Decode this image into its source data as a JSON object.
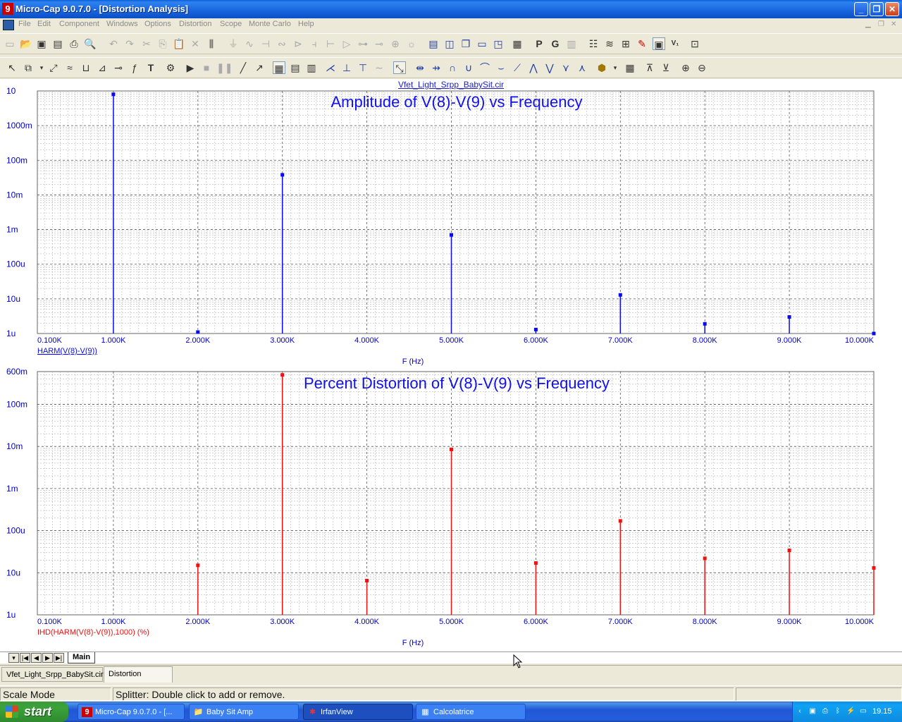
{
  "window": {
    "app_icon": "9",
    "title": "Micro-Cap 9.0.7.0 - [Distortion Analysis]",
    "controls": {
      "minimize": "_",
      "restore": "❐",
      "close": "✕"
    }
  },
  "menu": [
    "File",
    "Edit",
    "Component",
    "Windows",
    "Options",
    "Distortion",
    "Scope",
    "Monte Carlo",
    "Help"
  ],
  "toolbar_text": {
    "p": "P",
    "g": "G",
    "t": "T"
  },
  "plot": {
    "filename": "Vfet_Light_Srpp_BabySit.cir",
    "x_axis_label": "F (Hz)",
    "x_ticks": [
      "0.100K",
      "1.000K",
      "2.000K",
      "3.000K",
      "4.000K",
      "5.000K",
      "6.000K",
      "7.000K",
      "8.000K",
      "9.000K",
      "10.000K"
    ],
    "color_top": "#0a0aee",
    "color_bottom": "#ee1111"
  },
  "chart_data": [
    {
      "type": "bar",
      "title": "Amplitude of V(8)-V(9) vs Frequency",
      "xlabel": "F (Hz)",
      "ylabel": "",
      "y_scale": "log",
      "ylim": [
        1e-06,
        10
      ],
      "xlim": [
        100,
        10000
      ],
      "y_tick_labels": [
        "10",
        "1000m",
        "100m",
        "10m",
        "1m",
        "100u",
        "10u",
        "1u"
      ],
      "series": [
        {
          "name": "HARM(V(8)-V(9))",
          "x": [
            1000,
            2000,
            3000,
            5000,
            6000,
            7000,
            8000,
            9000,
            10000
          ],
          "y": [
            8.0,
            1.1e-06,
            0.038,
            0.0007,
            1.3e-06,
            1.3e-05,
            1.9e-06,
            3e-06,
            1e-06
          ]
        }
      ]
    },
    {
      "type": "bar",
      "title": "Percent Distortion of V(8)-V(9) vs Frequency",
      "xlabel": "F (Hz)",
      "ylabel": "",
      "y_scale": "log",
      "ylim": [
        1e-06,
        0.6
      ],
      "xlim": [
        100,
        10000
      ],
      "y_tick_labels": [
        "600m",
        "100m",
        "10m",
        "1m",
        "100u",
        "10u",
        "1u"
      ],
      "series": [
        {
          "name": "IHD(HARM(V(8)-V(9)),1000) (%)",
          "x": [
            2000,
            3000,
            4000,
            5000,
            6000,
            7000,
            8000,
            9000,
            10000
          ],
          "y": [
            1.5e-05,
            0.5,
            6.5e-06,
            0.0085,
            1.7e-05,
            0.00017,
            2.2e-05,
            3.4e-05,
            1.3e-05
          ]
        }
      ]
    }
  ],
  "sheet_nav": {
    "first": "|◀",
    "prev": "◀",
    "next": "▶",
    "last": "▶|",
    "menu": "▾",
    "tab": "Main"
  },
  "doc_tabs": [
    "Vfet_Light_Srpp_BabySit.cir",
    "Distortion Analysis"
  ],
  "status": {
    "mode": "Scale Mode",
    "message": "Splitter: Double click to add or remove."
  },
  "taskbar": {
    "start": "start",
    "tasks": [
      {
        "label": "Micro-Cap 9.0.7.0 - [...",
        "icon": "9"
      },
      {
        "label": "Baby Sit Amp",
        "icon": "📁"
      },
      {
        "label": "IrfanView",
        "icon": "✱"
      },
      {
        "label": "Calcolatrice",
        "icon": "▦"
      }
    ],
    "clock": "19.15"
  }
}
